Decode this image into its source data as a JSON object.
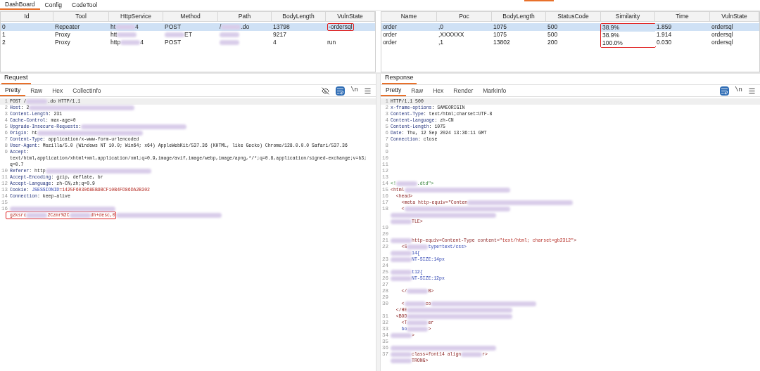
{
  "top_tabs": [
    {
      "label": "DashBoard",
      "selected": true
    },
    {
      "label": "Config",
      "selected": false
    },
    {
      "label": "CodeTool",
      "selected": false
    }
  ],
  "left_table": {
    "columns": [
      {
        "label": "Id"
      },
      {
        "label": "Tool"
      },
      {
        "label": "HttpService"
      },
      {
        "label": "Method"
      },
      {
        "label": "Path"
      },
      {
        "label": "BodyLength"
      },
      {
        "label": "VulnState"
      }
    ],
    "rows": [
      {
        "selected": true,
        "cells": [
          "0",
          "Repeater",
          [
            {
              "t": "ht"
            },
            {
              "kind": "blur"
            },
            {
              "t": "4"
            }
          ],
          "POST",
          [
            {
              "t": "/"
            },
            {
              "kind": "blur"
            },
            {
              "t": ".do"
            }
          ],
          "13798",
          {
            "t": "-ordersql",
            "boxed": true
          }
        ]
      },
      {
        "selected": false,
        "cells": [
          "1",
          "Proxy",
          [
            {
              "t": "htt"
            },
            {
              "kind": "blur"
            }
          ],
          [
            {
              "kind": "blur"
            },
            {
              "t": "ET"
            }
          ],
          [
            {
              "kind": "blur"
            }
          ],
          "9217",
          null
        ]
      },
      {
        "selected": false,
        "cells": [
          "2",
          "Proxy",
          [
            {
              "t": "http"
            },
            {
              "kind": "blur"
            },
            {
              "t": "4"
            }
          ],
          "POST",
          [
            {
              "kind": "blur"
            }
          ],
          "4",
          "run"
        ]
      }
    ]
  },
  "right_table": {
    "columns": [
      {
        "label": "Name"
      },
      {
        "label": "Poc"
      },
      {
        "label": "BodyLength"
      },
      {
        "label": "StatusCode"
      },
      {
        "label": "Similarity",
        "boxed": true
      },
      {
        "label": "Time"
      },
      {
        "label": "VulnState"
      }
    ],
    "rows": [
      {
        "selected": true,
        "cells": [
          "order",
          ",0",
          "1075",
          "500",
          "38.9%",
          "1.859",
          "ordersql"
        ]
      },
      {
        "selected": false,
        "cells": [
          "order",
          ",XXXXXX",
          "1075",
          "500",
          "38.9%",
          "1.914",
          "ordersql"
        ]
      },
      {
        "selected": false,
        "cells": [
          "order",
          ",1",
          "13802",
          "200",
          "100.0%",
          "0.030",
          "ordersql"
        ]
      }
    ]
  },
  "request": {
    "title": "Request",
    "tabs": [
      {
        "label": "Pretty",
        "selected": true
      },
      {
        "label": "Raw",
        "selected": false
      },
      {
        "label": "Hex",
        "selected": false
      },
      {
        "label": "CollectInfo",
        "selected": false
      }
    ],
    "tools": [
      {
        "kind": "eye-off",
        "on": false
      },
      {
        "kind": "wrap",
        "on": true
      },
      {
        "kind": "text",
        "label": "\\n"
      },
      {
        "kind": "menu"
      }
    ],
    "lines": [
      {
        "n": "1",
        "current": true,
        "segs": [
          {
            "t": "POST /",
            "kind": "text"
          },
          {
            "kind": "blur"
          },
          {
            "t": ".do HTTP/1.1",
            "kind": "text"
          }
        ]
      },
      {
        "n": "2",
        "current": false,
        "segs": [
          {
            "t": "Host",
            "kind": "key"
          },
          {
            "t": ": 2",
            "kind": "text"
          },
          {
            "kind": "blur"
          }
        ]
      },
      {
        "n": "3",
        "current": false,
        "segs": [
          {
            "t": "Content-Length",
            "kind": "key"
          },
          {
            "t": ": 231",
            "kind": "text"
          }
        ]
      },
      {
        "n": "4",
        "current": false,
        "segs": [
          {
            "t": "Cache-Control",
            "kind": "key"
          },
          {
            "t": ": max-age=0",
            "kind": "text"
          }
        ]
      },
      {
        "n": "5",
        "current": false,
        "segs": [
          {
            "t": "Upgrade-Insecure-Requests",
            "kind": "key"
          },
          {
            "t": ":",
            "kind": "text"
          },
          {
            "kind": "blur"
          }
        ]
      },
      {
        "n": "6",
        "current": false,
        "segs": [
          {
            "t": "Origin",
            "kind": "key"
          },
          {
            "t": ": ht",
            "kind": "text"
          },
          {
            "kind": "blur"
          }
        ]
      },
      {
        "n": "7",
        "current": false,
        "segs": [
          {
            "t": "Content-Type",
            "kind": "key"
          },
          {
            "t": ": application/x-www-form-urlencoded",
            "kind": "text"
          }
        ]
      },
      {
        "n": "8",
        "current": false,
        "segs": [
          {
            "t": "User-Agent",
            "kind": "key"
          },
          {
            "t": ": Mozilla/5.0 (Windows NT 10.0; Win64; x64) AppleWebKit/537.36 (KHTML, like Gecko) Chrome/128.0.0.0 Safari/537.36",
            "kind": "text"
          }
        ]
      },
      {
        "n": "9",
        "current": false,
        "segs": [
          {
            "t": "Accept",
            "kind": "key"
          },
          {
            "t": ":",
            "kind": "text"
          }
        ]
      },
      {
        "current": false,
        "segs": [
          {
            "t": "text/html,application/xhtml+xml,application/xml;q=0.9,image/avif,image/webp,image/apng,*/*;q=0.8,application/signed-exchange;v=b3;",
            "kind": "text"
          }
        ]
      },
      {
        "current": false,
        "segs": [
          {
            "t": "q=0.7",
            "kind": "text"
          }
        ]
      },
      {
        "n": "10",
        "current": false,
        "segs": [
          {
            "t": "Referer",
            "kind": "key"
          },
          {
            "t": ": http",
            "kind": "text"
          },
          {
            "kind": "blur"
          }
        ]
      },
      {
        "n": "11",
        "current": false,
        "segs": [
          {
            "t": "Accept-Encoding",
            "kind": "key"
          },
          {
            "t": ": gzip, deflate, br",
            "kind": "text"
          }
        ]
      },
      {
        "n": "12",
        "current": false,
        "segs": [
          {
            "t": "Accept-Language",
            "kind": "key"
          },
          {
            "t": ": zh-CN,zh;q=0.9",
            "kind": "text"
          }
        ]
      },
      {
        "n": "13",
        "current": false,
        "segs": [
          {
            "t": "Cookie",
            "kind": "key"
          },
          {
            "t": ": ",
            "kind": "text"
          },
          {
            "t": "JSESSIONID",
            "kind": "blue"
          },
          {
            "t": "=1425F603068EB9BCF10B4FD86DA2B302",
            "kind": "red"
          }
        ]
      },
      {
        "n": "14",
        "current": false,
        "segs": [
          {
            "t": "Connection",
            "kind": "key"
          },
          {
            "t": ": keep-alive",
            "kind": "text"
          }
        ]
      },
      {
        "n": "15",
        "current": false
      },
      {
        "n": "16",
        "current": false,
        "segs": [
          {
            "kind": "blur"
          }
        ]
      },
      {
        "current": false,
        "segs": [
          {
            "t": "gzksrc",
            "kind": "red",
            "boxed": true
          },
          {
            "kind": "blur",
            "boxed": true
          },
          {
            "t": "2Czmr%2C",
            "kind": "red",
            "boxed": true
          },
          {
            "kind": "blur",
            "boxed": true
          },
          {
            "t": "dh+desc,0",
            "kind": "red",
            "boxed": true
          },
          {
            "kind": "blur"
          }
        ]
      }
    ]
  },
  "response": {
    "title": "Response",
    "tabs": [
      {
        "label": "Pretty",
        "selected": true
      },
      {
        "label": "Raw",
        "selected": false
      },
      {
        "label": "Hex",
        "selected": false
      },
      {
        "label": "Render",
        "selected": false
      },
      {
        "label": "MarkInfo",
        "selected": false
      }
    ],
    "tools": [
      {
        "kind": "wrap",
        "on": true
      },
      {
        "kind": "text",
        "label": "\\n"
      },
      {
        "kind": "menu"
      }
    ],
    "lines": [
      {
        "n": "1",
        "current": true,
        "segs": [
          {
            "t": "HTTP/1.1 500",
            "kind": "text"
          }
        ]
      },
      {
        "n": "2",
        "current": false,
        "segs": [
          {
            "t": "x-frame-options",
            "kind": "key"
          },
          {
            "t": ": SAMEORIGIN",
            "kind": "text"
          }
        ]
      },
      {
        "n": "3",
        "current": false,
        "segs": [
          {
            "t": "Content-Type",
            "kind": "key"
          },
          {
            "t": ": text/html;charset=UTF-8",
            "kind": "text"
          }
        ]
      },
      {
        "n": "4",
        "current": false,
        "segs": [
          {
            "t": "Content-Language",
            "kind": "key"
          },
          {
            "t": ": zh-CN",
            "kind": "text"
          }
        ]
      },
      {
        "n": "5",
        "current": false,
        "segs": [
          {
            "t": "Content-Length",
            "kind": "key"
          },
          {
            "t": ": 1075",
            "kind": "text"
          }
        ]
      },
      {
        "n": "6",
        "current": false,
        "segs": [
          {
            "t": "Date",
            "kind": "key"
          },
          {
            "t": ": Thu, 12 Sep 2024 13:36:11 GMT",
            "kind": "text"
          }
        ]
      },
      {
        "n": "7",
        "current": false,
        "segs": [
          {
            "t": "Connection",
            "kind": "key"
          },
          {
            "t": ": close",
            "kind": "text"
          }
        ]
      },
      {
        "n": "8",
        "current": false
      },
      {
        "n": "9",
        "current": false
      },
      {
        "n": "10",
        "current": false
      },
      {
        "n": "11",
        "current": false
      },
      {
        "n": "12",
        "current": false
      },
      {
        "n": "13",
        "current": false
      },
      {
        "n": "14",
        "current": false,
        "segs": [
          {
            "t": "<!",
            "kind": "green"
          },
          {
            "kind": "blur"
          },
          {
            "t": ".dtd\">",
            "kind": "green"
          }
        ]
      },
      {
        "n": "15",
        "current": false,
        "segs": [
          {
            "t": "<html",
            "kind": "tag"
          },
          {
            "kind": "blur"
          }
        ]
      },
      {
        "n": "16",
        "current": false,
        "segs": [
          {
            "t": "  <head>",
            "kind": "tag"
          }
        ]
      },
      {
        "n": "17",
        "current": false,
        "segs": [
          {
            "t": "    <meta http-equiv=\"Conten",
            "kind": "tag"
          },
          {
            "kind": "blur"
          }
        ]
      },
      {
        "n": "18",
        "current": false,
        "segs": [
          {
            "t": "    <",
            "kind": "tag"
          },
          {
            "kind": "blur"
          }
        ]
      },
      {
        "current": false,
        "segs": [
          {
            "kind": "blur"
          }
        ]
      },
      {
        "current": false,
        "segs": [
          {
            "kind": "blur"
          },
          {
            "t": "TLE>",
            "kind": "tag"
          }
        ]
      },
      {
        "n": "19",
        "current": false
      },
      {
        "n": "20",
        "current": false
      },
      {
        "n": "21",
        "current": false,
        "segs": [
          {
            "kind": "blur"
          },
          {
            "t": "http-equiv=Content-Type content=",
            "kind": "tag"
          },
          {
            "t": "\"text/html; charset=gb2312\"",
            "kind": "red"
          },
          {
            "t": ">",
            "kind": "tag"
          }
        ]
      },
      {
        "n": "22",
        "current": false,
        "segs": [
          {
            "t": "    <S",
            "kind": "tag"
          },
          {
            "kind": "blur"
          },
          {
            "t": "type=text/css>",
            "kind": "blue"
          }
        ]
      },
      {
        "current": false,
        "segs": [
          {
            "kind": "blur"
          },
          {
            "t": "14{",
            "kind": "blue"
          }
        ]
      },
      {
        "n": "23",
        "current": false,
        "segs": [
          {
            "kind": "blur"
          },
          {
            "t": "NT-SIZE:14px",
            "kind": "blue"
          }
        ]
      },
      {
        "n": "24",
        "current": false
      },
      {
        "n": "25",
        "current": false,
        "segs": [
          {
            "kind": "blur"
          },
          {
            "t": "t12{",
            "kind": "blue"
          }
        ]
      },
      {
        "n": "26",
        "current": false,
        "segs": [
          {
            "kind": "blur"
          },
          {
            "t": "NT-SIZE:12px",
            "kind": "blue"
          }
        ]
      },
      {
        "n": "27",
        "current": false
      },
      {
        "n": "28",
        "current": false,
        "segs": [
          {
            "t": "    </",
            "kind": "tag"
          },
          {
            "kind": "blur"
          },
          {
            "t": "B>",
            "kind": "tag"
          }
        ]
      },
      {
        "n": "29",
        "current": false
      },
      {
        "n": "30",
        "current": false,
        "segs": [
          {
            "t": "    <",
            "kind": "tag"
          },
          {
            "kind": "blur"
          },
          {
            "t": "co",
            "kind": "tag"
          },
          {
            "kind": "blur"
          }
        ]
      },
      {
        "current": false,
        "segs": [
          {
            "t": "  </HE",
            "kind": "tag"
          },
          {
            "kind": "blur"
          }
        ]
      },
      {
        "n": "31",
        "current": false,
        "segs": [
          {
            "t": "  <BOD",
            "kind": "tag"
          },
          {
            "kind": "blur"
          }
        ]
      },
      {
        "n": "32",
        "current": false,
        "segs": [
          {
            "t": "    <T",
            "kind": "tag"
          },
          {
            "kind": "blur"
          },
          {
            "t": "er",
            "kind": "tag"
          }
        ]
      },
      {
        "n": "33",
        "current": false,
        "segs": [
          {
            "t": "    bo",
            "kind": "blue"
          },
          {
            "kind": "blur"
          },
          {
            "t": ">",
            "kind": "tag"
          }
        ]
      },
      {
        "n": "34",
        "current": false,
        "segs": [
          {
            "kind": "blur"
          },
          {
            "t": ">",
            "kind": "tag"
          }
        ]
      },
      {
        "n": "35",
        "current": false
      },
      {
        "n": "36",
        "current": false,
        "segs": [
          {
            "kind": "blur"
          }
        ]
      },
      {
        "n": "37",
        "current": false,
        "segs": [
          {
            "kind": "blur"
          },
          {
            "t": "class=font14 align",
            "kind": "tag"
          },
          {
            "kind": "blur"
          },
          {
            "t": "r>",
            "kind": "tag"
          }
        ]
      },
      {
        "current": false,
        "segs": [
          {
            "kind": "blur"
          },
          {
            "t": "TRONG>",
            "kind": "tag"
          }
        ]
      }
    ]
  }
}
